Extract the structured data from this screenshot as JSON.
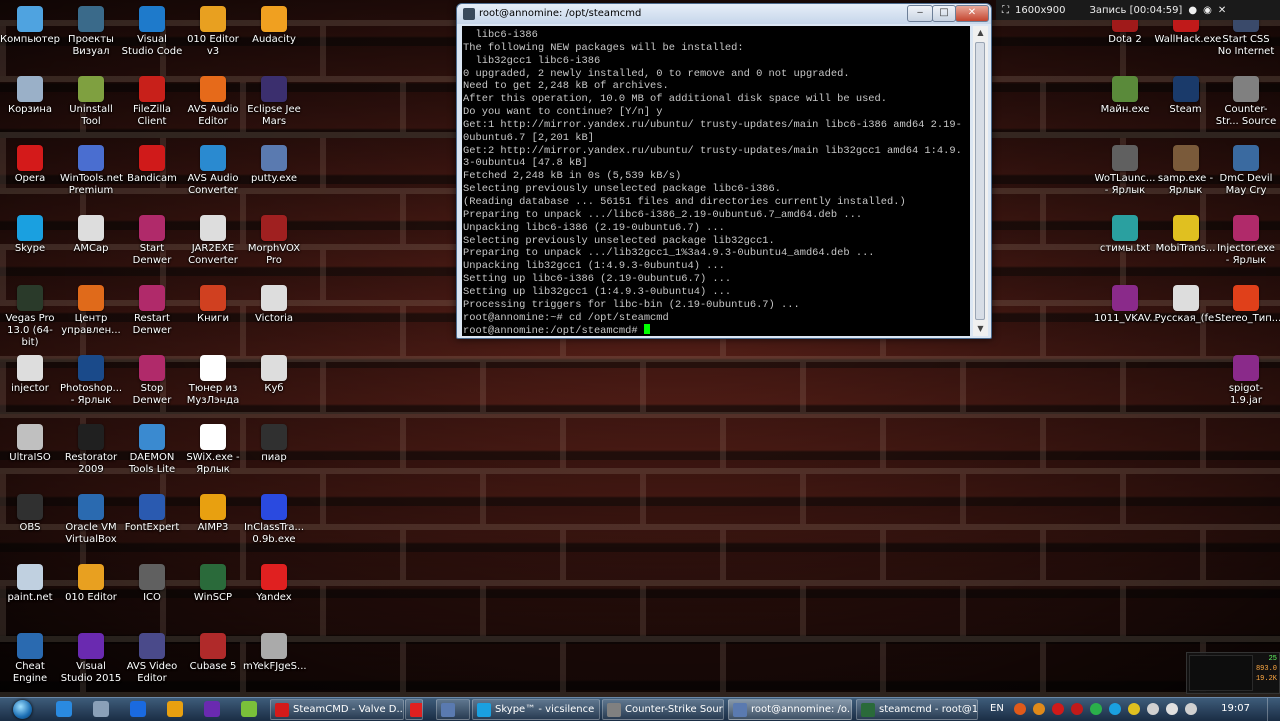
{
  "desktop": {
    "icons_left": [
      {
        "label": "Компьютер",
        "icon": "computer-icon",
        "color": "#4fa3e0"
      },
      {
        "label": "Проекты Визуал",
        "icon": "folder-icon",
        "color": "#3a6a8a"
      },
      {
        "label": "Visual Studio Code",
        "icon": "vscode-icon",
        "color": "#1e7acb"
      },
      {
        "label": "010 Editor v3",
        "icon": "editor-icon",
        "color": "#e8a020"
      },
      {
        "label": "Audacity",
        "icon": "audacity-icon",
        "color": "#f0a020"
      },
      {
        "label": "Корзина",
        "icon": "recycle-bin-icon",
        "color": "#9ab0c8"
      },
      {
        "label": "Uninstall Tool",
        "icon": "uninstall-icon",
        "color": "#7fa040"
      },
      {
        "label": "FileZilla Client",
        "icon": "filezilla-icon",
        "color": "#c8201a"
      },
      {
        "label": "AVS Audio Editor",
        "icon": "avs-audio-icon",
        "color": "#e66a1a"
      },
      {
        "label": "Eclipse Jee Mars",
        "icon": "eclipse-icon",
        "color": "#3b2f6e"
      },
      {
        "label": "Opera",
        "icon": "opera-icon",
        "color": "#d41a1a"
      },
      {
        "label": "WinTools.net Premium",
        "icon": "wintools-icon",
        "color": "#4a6ed0"
      },
      {
        "label": "Bandicam",
        "icon": "bandicam-icon",
        "color": "#d01a1a"
      },
      {
        "label": "AVS Audio Converter",
        "icon": "avs-converter-icon",
        "color": "#2a8ad0"
      },
      {
        "label": "putty.exe",
        "icon": "putty-icon",
        "color": "#5a7ab0"
      },
      {
        "label": "Skype",
        "icon": "skype-icon",
        "color": "#1aa0e0"
      },
      {
        "label": "AMCap",
        "icon": "amcap-icon",
        "color": "#ddd"
      },
      {
        "label": "Start Denwer",
        "icon": "denwer-icon",
        "color": "#b02a6a"
      },
      {
        "label": "JAR2EXE Converter",
        "icon": "jar2exe-icon",
        "color": "#ddd"
      },
      {
        "label": "MorphVOX Pro",
        "icon": "morphvox-icon",
        "color": "#a02020"
      },
      {
        "label": "Vegas Pro 13.0 (64-bit)",
        "icon": "vegas-icon",
        "color": "#2a3a2a"
      },
      {
        "label": "Центр управлен...",
        "icon": "control-center-icon",
        "color": "#e06a1a"
      },
      {
        "label": "Restart Denwer",
        "icon": "denwer-restart-icon",
        "color": "#b02a6a"
      },
      {
        "label": "Книги",
        "icon": "books-icon",
        "color": "#d04020"
      },
      {
        "label": "Victoria",
        "icon": "victoria-icon",
        "color": "#ddd"
      },
      {
        "label": "injector",
        "icon": "injector-icon",
        "color": "#ddd"
      },
      {
        "label": "Photoshop... - Ярлык",
        "icon": "photoshop-icon",
        "color": "#1a4a8a"
      },
      {
        "label": "Stop Denwer",
        "icon": "denwer-stop-icon",
        "color": "#b02a6a"
      },
      {
        "label": "Тюнер из МузЛэнда",
        "icon": "tuner-icon",
        "color": "#fff"
      },
      {
        "label": "Куб",
        "icon": "cube-icon",
        "color": "#ddd"
      },
      {
        "label": "UltraISO",
        "icon": "ultraiso-icon",
        "color": "#c0c0c0"
      },
      {
        "label": "Restorator 2009",
        "icon": "restorator-icon",
        "color": "#202020"
      },
      {
        "label": "DAEMON Tools Lite",
        "icon": "daemon-icon",
        "color": "#3a8ad0"
      },
      {
        "label": "SWiX.exe - Ярлык",
        "icon": "swix-icon",
        "color": "#fff"
      },
      {
        "label": "пиар",
        "icon": "folder-pr-icon",
        "color": "#303030"
      },
      {
        "label": "OBS",
        "icon": "obs-icon",
        "color": "#303030"
      },
      {
        "label": "Oracle VM VirtualBox",
        "icon": "virtualbox-icon",
        "color": "#2a6ab0"
      },
      {
        "label": "FontExpert",
        "icon": "fontexpert-icon",
        "color": "#2a5ab0"
      },
      {
        "label": "AIMP3",
        "icon": "aimp-icon",
        "color": "#e8a010"
      },
      {
        "label": "InClassTra... 0.9b.exe",
        "icon": "inclass-icon",
        "color": "#2a4ae0"
      },
      {
        "label": "paint.net",
        "icon": "paintnet-icon",
        "color": "#c0d0e0"
      },
      {
        "label": "010 Editor",
        "icon": "editor-010-icon",
        "color": "#e8a020"
      },
      {
        "label": "ICO",
        "icon": "ico-icon",
        "color": "#606060"
      },
      {
        "label": "WinSCP",
        "icon": "winscp-icon",
        "color": "#2a6a3a"
      },
      {
        "label": "Yandex",
        "icon": "yandex-icon",
        "color": "#e02020"
      },
      {
        "label": "Cheat Engine",
        "icon": "cheat-engine-icon",
        "color": "#2a6ab0"
      },
      {
        "label": "Visual Studio 2015",
        "icon": "vs2015-icon",
        "color": "#6a2ab0"
      },
      {
        "label": "AVS Video Editor",
        "icon": "avs-video-icon",
        "color": "#4a4a8a"
      },
      {
        "label": "Cubase 5",
        "icon": "cubase-icon",
        "color": "#b02a2a"
      },
      {
        "label": "mYekFJgeS...",
        "icon": "file-icon",
        "color": "#aaa"
      }
    ],
    "icons_right": [
      {
        "label": "Dota 2",
        "icon": "dota-icon",
        "color": "#a01a1a"
      },
      {
        "label": "WallHack.exe",
        "icon": "wallhack-icon",
        "color": "#c01a1a"
      },
      {
        "label": "Start CSS No Internet",
        "icon": "css-icon",
        "color": "#3a4a6a"
      },
      {
        "label": "Майн.exe",
        "icon": "minecraft-icon",
        "color": "#5a8a3a"
      },
      {
        "label": "Steam",
        "icon": "steam-icon",
        "color": "#1a3a6a"
      },
      {
        "label": "Counter-Str... Source",
        "icon": "counter-strike-icon",
        "color": "#808080"
      },
      {
        "label": "WoTLaunc... - Ярлык",
        "icon": "wot-icon",
        "color": "#606060"
      },
      {
        "label": "samp.exe - Ярлык",
        "icon": "samp-icon",
        "color": "#7a5a3a"
      },
      {
        "label": "DmC Devil May Cry",
        "icon": "dmc-icon",
        "color": "#3a6aa0"
      },
      {
        "label": "стимы.txt",
        "icon": "text-file-icon",
        "color": "#2aa0a0"
      },
      {
        "label": "MobiTrans...",
        "icon": "mobitrans-icon",
        "color": "#e0c020"
      },
      {
        "label": "Injector.exe - Ярлык",
        "icon": "injector-exe-icon",
        "color": "#b02a6a"
      },
      {
        "label": "1011_VKAV...",
        "icon": "rar-icon",
        "color": "#8a2a8a"
      },
      {
        "label": "Русская_(fe...",
        "icon": "music-file-icon",
        "color": "#ddd"
      },
      {
        "label": "Stereo_Тип...",
        "icon": "mp3-icon",
        "color": "#e0401a"
      },
      {
        "label": "spigot-1.9.jar",
        "icon": "jar-icon",
        "color": "#8a2a8a"
      }
    ]
  },
  "recording_bar": {
    "resolution": "1600x900",
    "recording": "Запись [00:04:59]"
  },
  "terminal": {
    "title": "root@annomine: /opt/steamcmd",
    "minimize": "‒",
    "maximize": "□",
    "close": "✕",
    "lines": [
      "  libc6-i386",
      "The following NEW packages will be installed:",
      "  lib32gcc1 libc6-i386",
      "0 upgraded, 2 newly installed, 0 to remove and 0 not upgraded.",
      "Need to get 2,248 kB of archives.",
      "After this operation, 10.0 MB of additional disk space will be used.",
      "Do you want to continue? [Y/n] y",
      "Get:1 http://mirror.yandex.ru/ubuntu/ trusty-updates/main libc6-i386 amd64 2.19-",
      "0ubuntu6.7 [2,201 kB]",
      "Get:2 http://mirror.yandex.ru/ubuntu/ trusty-updates/main lib32gcc1 amd64 1:4.9.",
      "3-0ubuntu4 [47.8 kB]",
      "Fetched 2,248 kB in 0s (5,539 kB/s)",
      "Selecting previously unselected package libc6-i386.",
      "(Reading database ... 56151 files and directories currently installed.)",
      "Preparing to unpack .../libc6-i386_2.19-0ubuntu6.7_amd64.deb ...",
      "Unpacking libc6-i386 (2.19-0ubuntu6.7) ...",
      "Selecting previously unselected package lib32gcc1.",
      "Preparing to unpack .../lib32gcc1_1%3a4.9.3-0ubuntu4_amd64.deb ...",
      "Unpacking lib32gcc1 (1:4.9.3-0ubuntu4) ...",
      "Setting up libc6-i386 (2.19-0ubuntu6.7) ...",
      "Setting up lib32gcc1 (1:4.9.3-0ubuntu4) ...",
      "Processing triggers for libc-bin (2.19-0ubuntu6.7) ...",
      "root@annomine:~# cd /opt/steamcmd"
    ],
    "prompt": "root@annomine:/opt/steamcmd# "
  },
  "taskbar": {
    "quicklaunch": [
      {
        "icon": "ie-icon",
        "color": "#2a8ae0"
      },
      {
        "icon": "drive-icon",
        "color": "#8aa0b8"
      },
      {
        "icon": "teamviewer-icon",
        "color": "#1a6ae0"
      },
      {
        "icon": "aimp-task-icon",
        "color": "#e8a010"
      },
      {
        "icon": "vs-task-icon",
        "color": "#6a2ab0"
      },
      {
        "icon": "android-icon",
        "color": "#7ac03a"
      }
    ],
    "buttons": [
      {
        "label": "SteamCMD - Valve D...",
        "icon": "opera-task-icon",
        "color": "#d41a1a",
        "active": false
      },
      {
        "label": "",
        "icon": "yandex-task-icon",
        "color": "#e02020",
        "active": false
      },
      {
        "label": "",
        "icon": "putty-task-icon",
        "color": "#5a7ab0",
        "active": false
      },
      {
        "label": "Skype™ - vicsilence",
        "icon": "skype-task-icon",
        "color": "#1aa0e0",
        "active": false
      },
      {
        "label": "Counter-Strike Source",
        "icon": "cs-task-icon",
        "color": "#808080",
        "active": false
      },
      {
        "label": "root@annomine: /o...",
        "icon": "putty-term-task-icon",
        "color": "#5a7ab0",
        "active": true
      },
      {
        "label": "steamcmd - root@1...",
        "icon": "winscp-task-icon",
        "color": "#2a6a3a",
        "active": false
      }
    ],
    "tray": {
      "language": "EN",
      "time": "19:07",
      "icons": [
        {
          "icon": "tray-flag-icon",
          "color": "#e05a1a"
        },
        {
          "icon": "tray-warn-icon",
          "color": "#e08a1a"
        },
        {
          "icon": "tray-red-icon",
          "color": "#d01a1a"
        },
        {
          "icon": "tray-rec-icon",
          "color": "#c01a1a"
        },
        {
          "icon": "tray-green-icon",
          "color": "#2ab04a"
        },
        {
          "icon": "tray-skype-icon",
          "color": "#1aa0e0"
        },
        {
          "icon": "tray-yellow-icon",
          "color": "#e0c020"
        },
        {
          "icon": "tray-network-icon",
          "color": "#d0d0d0"
        },
        {
          "icon": "tray-flag2-icon",
          "color": "#e0e0e0"
        },
        {
          "icon": "tray-volume-icon",
          "color": "#d0d0d0"
        }
      ]
    }
  },
  "widget": {
    "values": [
      "25",
      "893.0",
      "19.2K"
    ]
  }
}
